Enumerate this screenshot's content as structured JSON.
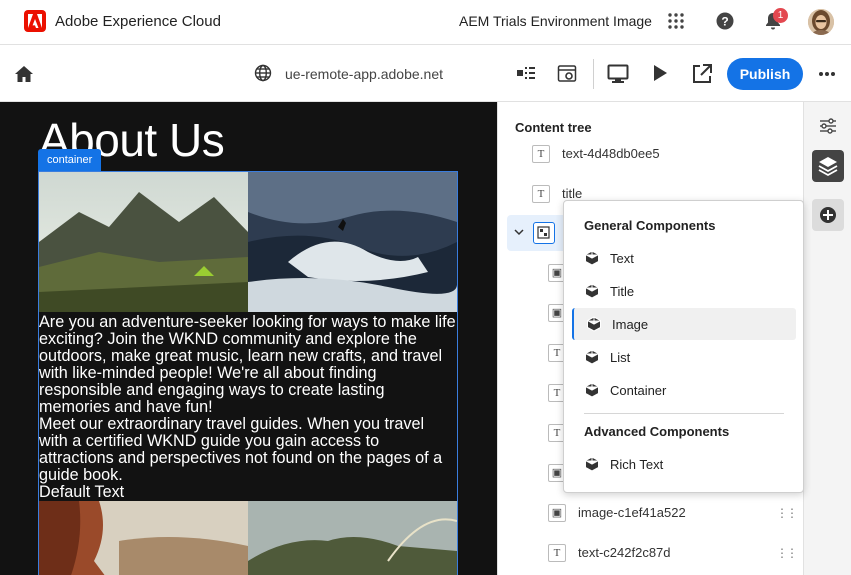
{
  "header": {
    "brand": "Adobe Experience Cloud",
    "environment": "AEM Trials Environment Image",
    "notification_count": "1",
    "brand_color": "#eb1000"
  },
  "toolbar": {
    "url": "ue-remote-app.adobe.net",
    "publish_label": "Publish",
    "accent": "#1473e6"
  },
  "canvas": {
    "page_title": "About Us",
    "container_tag": "container",
    "body_text": [
      "Are you an adventure-seeker looking for ways to make life exciting? Join the WKND community and explore the outdoors, make great music, learn new crafts, and travel with like-minded people! We're all about finding responsible and engaging ways to create lasting memories and have fun!",
      "Meet our extraordinary travel guides. When you travel with a certified WKND guide you gain access to attractions and perspectives not found on the pages of a guide book.",
      "Default Text"
    ]
  },
  "panel": {
    "title": "Content tree",
    "items": [
      {
        "icon": "text-icon",
        "label": "text-4d48db0ee5"
      },
      {
        "icon": "text-icon",
        "label": "title"
      },
      {
        "icon": "container-icon",
        "label": ""
      },
      {
        "icon": "image-icon",
        "label": ""
      },
      {
        "icon": "image-icon",
        "label": ""
      },
      {
        "icon": "text-icon",
        "label": ""
      },
      {
        "icon": "text-icon",
        "label": ""
      },
      {
        "icon": "text-icon",
        "label": ""
      },
      {
        "icon": "image-icon",
        "label": ""
      },
      {
        "icon": "image-icon",
        "label": "image-c1ef41a522"
      },
      {
        "icon": "text-icon",
        "label": "text-c242f2c87d"
      }
    ]
  },
  "popover": {
    "general_heading": "General Components",
    "general_items": [
      "Text",
      "Title",
      "Image",
      "List",
      "Container"
    ],
    "active_item": "Image",
    "advanced_heading": "Advanced Components",
    "advanced_items": [
      "Rich Text"
    ]
  }
}
